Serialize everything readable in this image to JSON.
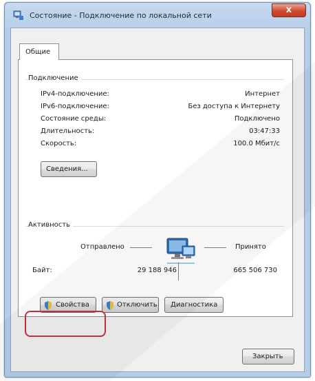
{
  "window": {
    "title": "Состояние - Подключение по локальной сети",
    "close_label": "x"
  },
  "tabs": [
    {
      "label": "Общие"
    }
  ],
  "connection": {
    "group_label": "Подключение",
    "rows": [
      {
        "label": "IPv4-подключение:",
        "value": "Интернет"
      },
      {
        "label": "IPv6-подключение:",
        "value": "Без доступа к Интернету"
      },
      {
        "label": "Состояние среды:",
        "value": "Подключено"
      },
      {
        "label": "Длительность:",
        "value": "03:47:33"
      },
      {
        "label": "Скорость:",
        "value": "100.0 Мбит/с"
      }
    ],
    "details_button": "Сведения..."
  },
  "activity": {
    "group_label": "Активность",
    "sent_label": "Отправлено",
    "received_label": "Принято",
    "bytes_label": "Байт:",
    "bytes_sent": "29 188 946",
    "bytes_received": "665 506 730"
  },
  "buttons": {
    "properties": "Свойства",
    "disable": "Отключить",
    "diagnose": "Диагностика",
    "close": "Закрыть"
  },
  "colors": {
    "highlight": "#c8303a",
    "frame_accent": "#b5cde8"
  }
}
